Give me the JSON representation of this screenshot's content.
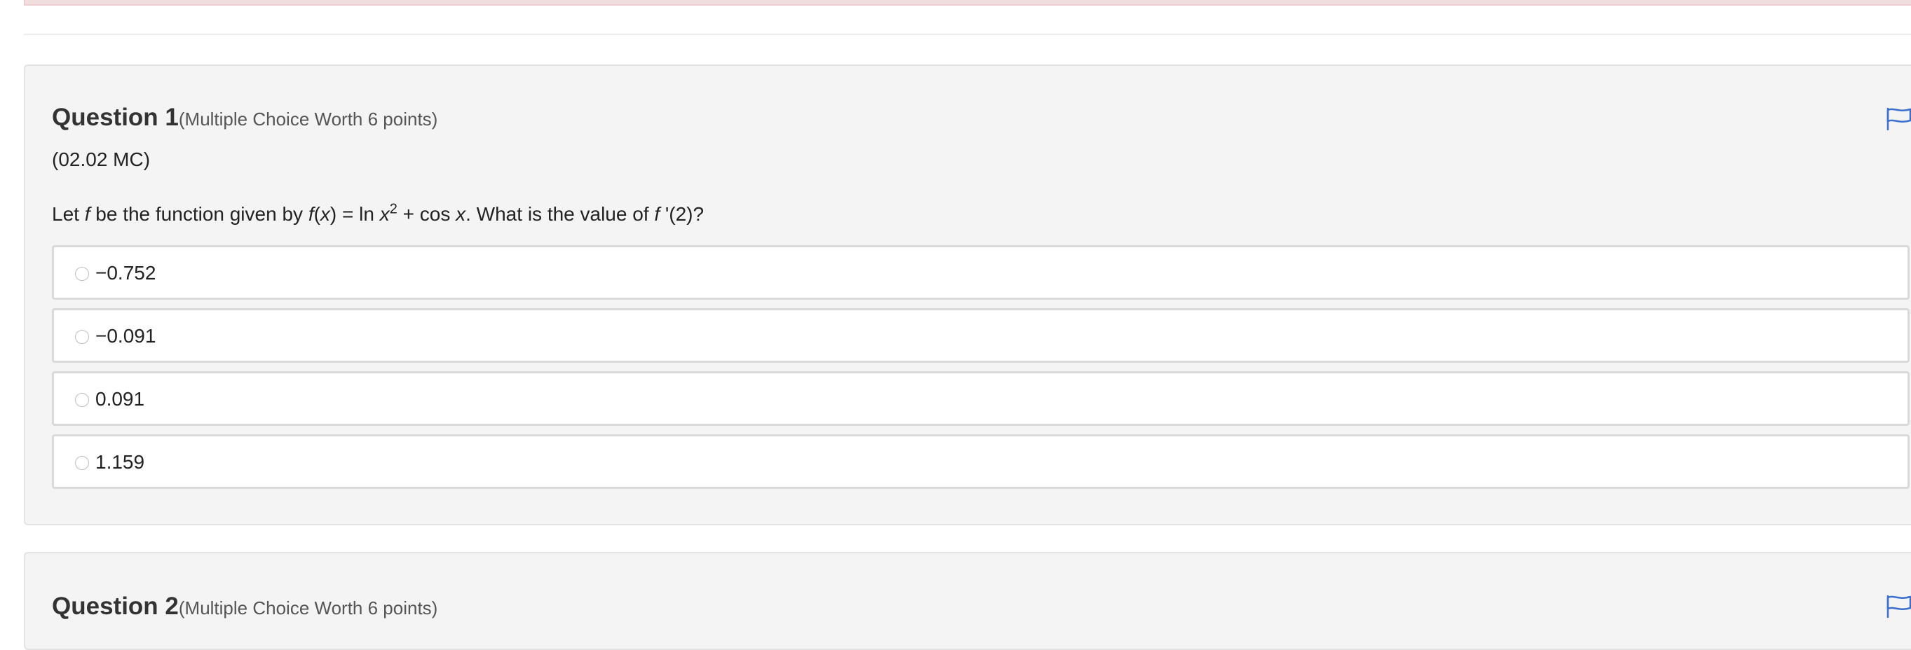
{
  "colors": {
    "flag": "#3a6fcf",
    "alert_bg": "#f2dede",
    "panel_bg": "#f4f4f4",
    "choice_border": "#d9d9d9"
  },
  "questions": [
    {
      "title": "Question 1",
      "worth": "(Multiple Choice Worth 6 points)",
      "code": "(02.02 MC)",
      "prompt": {
        "p1": "Let ",
        "f1": "f",
        "p2": " be the function given by ",
        "f2": "f",
        "p3": "(",
        "x1": "x",
        "p4": ") = ln ",
        "x2": "x",
        "exp": "2",
        "p5": " + cos ",
        "x3": "x",
        "p6": ". What is the value of ",
        "f3": "f",
        "p7": " '(2)?"
      },
      "flag_icon": "flag-icon",
      "choices": [
        "−0.752",
        "−0.091",
        "0.091",
        "1.159"
      ]
    },
    {
      "title": "Question 2",
      "worth": "(Multiple Choice Worth 6 points)",
      "flag_icon": "flag-icon"
    }
  ]
}
